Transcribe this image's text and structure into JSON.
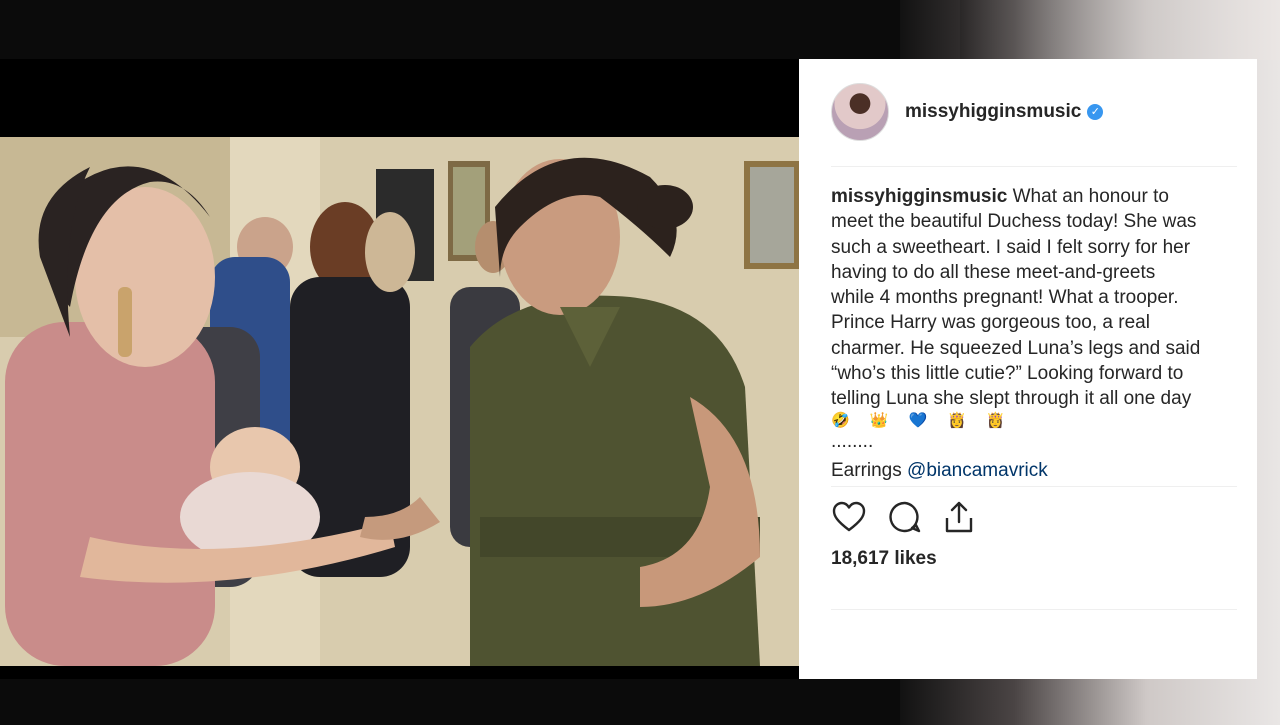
{
  "post": {
    "username": "missyhigginsmusic",
    "verified_icon": "verified-badge-icon",
    "caption_user": "missyhigginsmusic",
    "caption_lines": [
      "What an honour to",
      "meet the beautiful Duchess today! She was",
      "such a sweetheart. I said I felt sorry for her",
      "having to do all these meet-and-greets",
      "while 4 months pregnant! What a trooper.",
      "Prince Harry was gorgeous too, a real",
      "charmer. He squeezed Luna’s legs and said",
      "“who’s this little cutie?” Looking forward to",
      "telling Luna she slept through it all one day"
    ],
    "emojis": "🤣 👑 💙 👸 👸",
    "dots": "........",
    "earrings_label": "Earrings",
    "earrings_mention": "@biancamavrick",
    "likes": "18,617 likes"
  },
  "icons": {
    "like": "heart-icon",
    "comment": "comment-icon",
    "share": "share-icon"
  },
  "colors": {
    "verified": "#3897f0",
    "mention": "#003569",
    "text": "#262626"
  }
}
